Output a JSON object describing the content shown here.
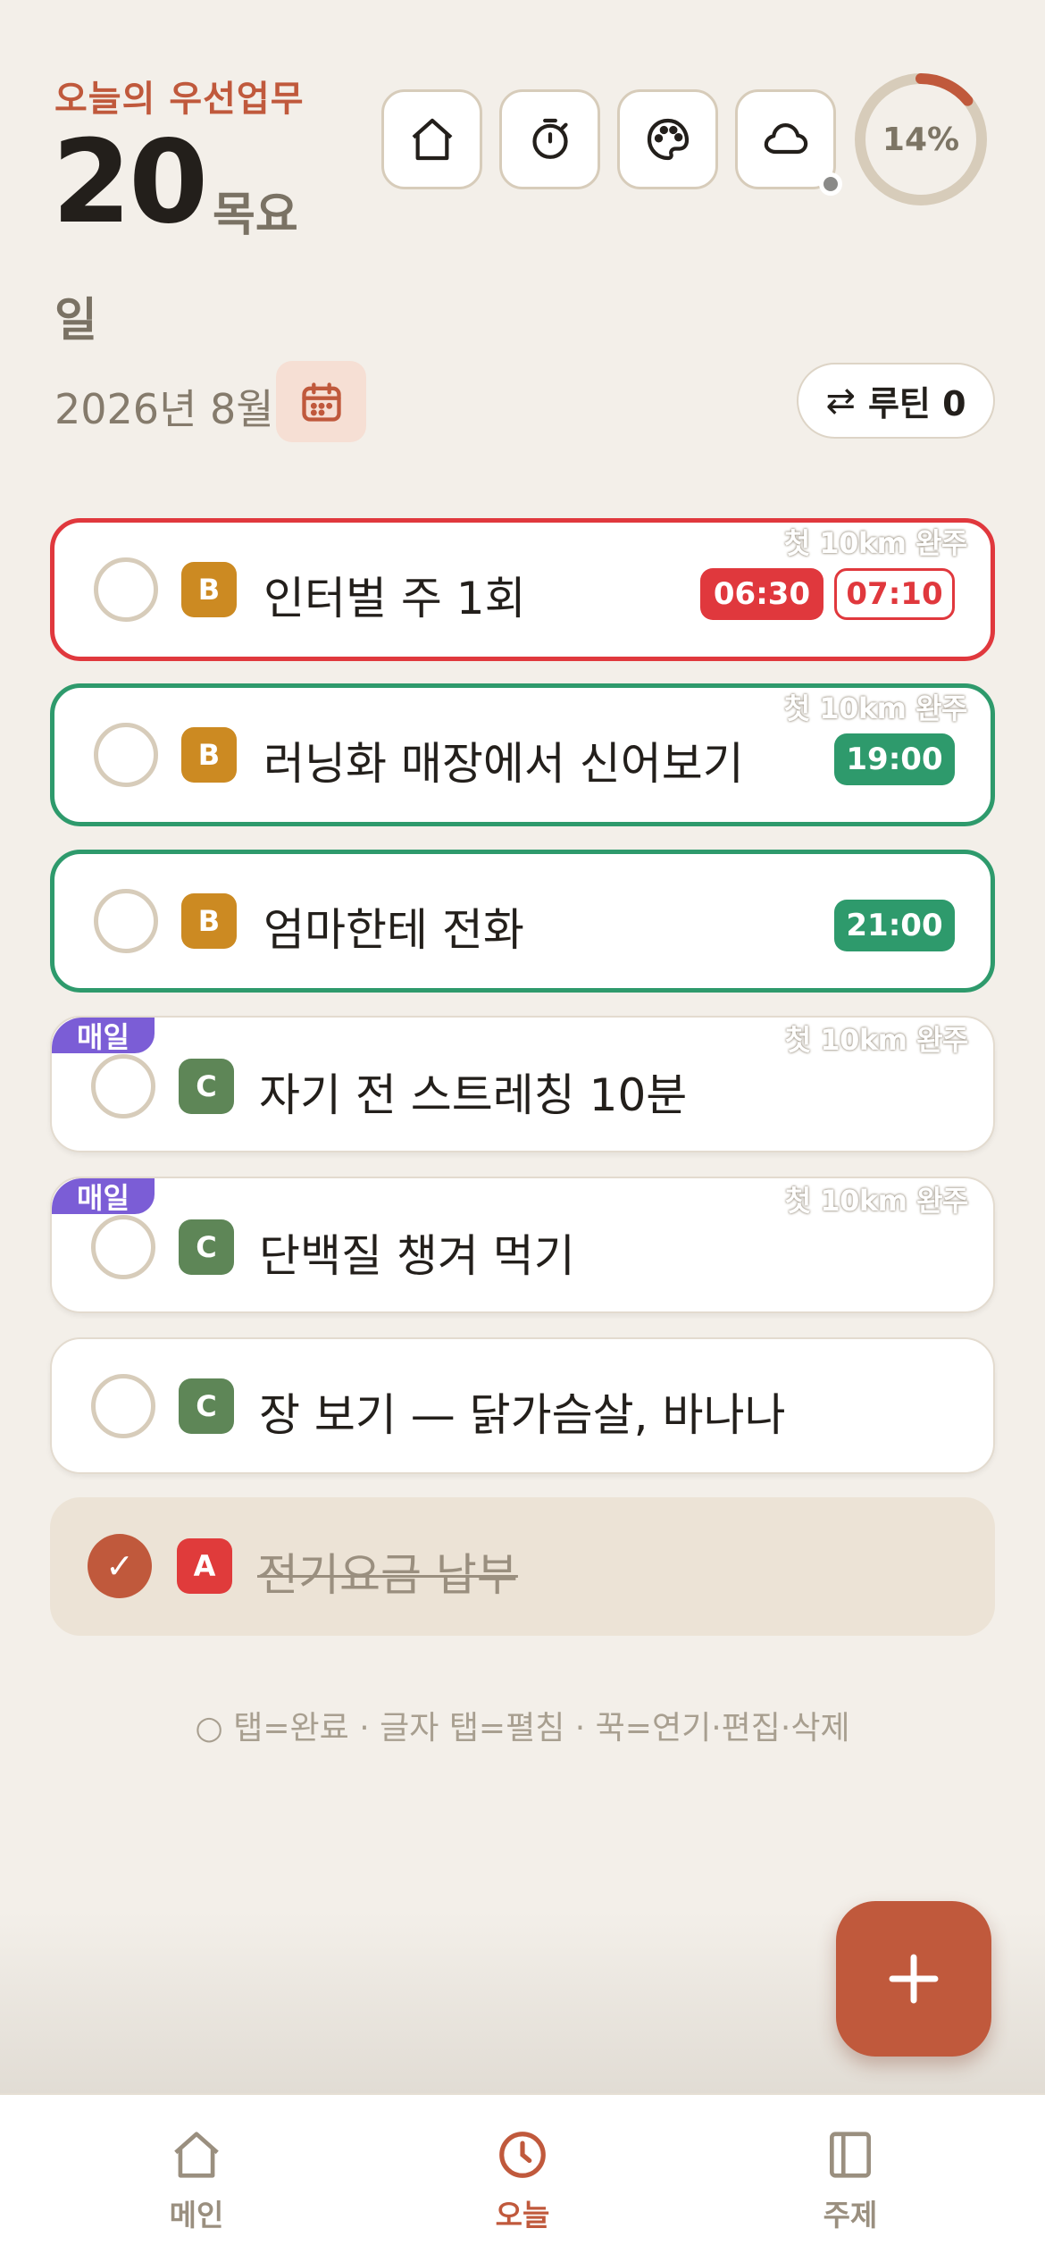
{
  "header": {
    "priority_label": "오늘의 우선업무",
    "day": "20",
    "weekday": "목요",
    "weekday_cont": "일",
    "year_month": "2026년 8월",
    "progress_percent": 14,
    "progress_label": "14%",
    "routine_label": "루틴 0",
    "routine_icon": "⇄",
    "icons": [
      "home-icon",
      "timer-icon",
      "palette-icon",
      "cloud-icon",
      "calendar-icon"
    ]
  },
  "tasks": [
    {
      "grade": "B",
      "title": "인터벌 주 1회",
      "goal": "첫 10km 완주",
      "times": [
        "06:30",
        "07:10"
      ],
      "border": "#e0383d"
    },
    {
      "grade": "B",
      "title": "러닝화 매장에서 신어보기",
      "goal": "첫 10km 완주",
      "times": [
        "19:00"
      ],
      "border": "#2e9a6c"
    },
    {
      "grade": "B",
      "title": "엄마한테 전화",
      "times": [
        "21:00"
      ],
      "border": "#2e9a6c"
    },
    {
      "grade": "C",
      "title": "자기 전 스트레칭 10분",
      "goal": "첫 10km 완주",
      "repeat": "매일"
    },
    {
      "grade": "C",
      "title": "단백질 챙겨 먹기",
      "goal": "첫 10km 완주",
      "repeat": "매일"
    },
    {
      "grade": "C",
      "title": "장 보기 — 닭가슴살, 바나나"
    },
    {
      "grade": "A",
      "title": "전기요금 납부",
      "done": true,
      "check": "✓"
    }
  ],
  "hint": "○ 탭=완료 · 글자 탭=펼침 · 꾹=연기·편집·삭제",
  "fab_icon": "plus-icon",
  "tabbar": [
    {
      "label": "메인",
      "icon": "home-icon"
    },
    {
      "label": "오늘",
      "icon": "clock-icon",
      "active": true
    },
    {
      "label": "주제",
      "icon": "book-icon"
    }
  ],
  "colors": {
    "accent": "#c0593c",
    "background": "#f3efe9",
    "grade_A": "#e03b3b",
    "grade_B": "#cc8a22",
    "grade_C": "#5e8657",
    "daily_tag": "#7b5dd6"
  }
}
